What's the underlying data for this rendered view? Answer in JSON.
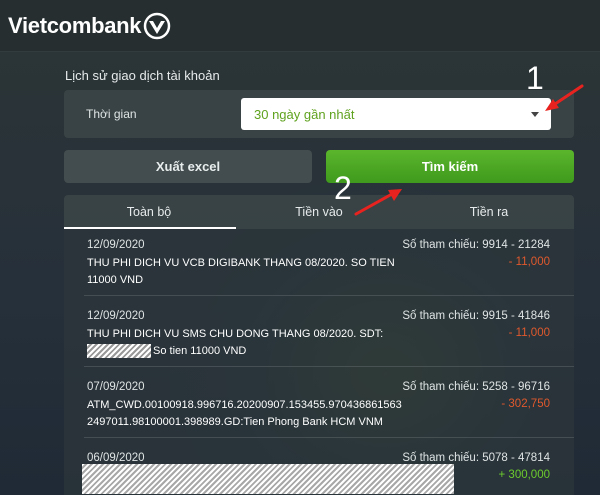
{
  "brand": {
    "name": "Vietcombank"
  },
  "page": {
    "section_title": "Lịch sử giao dịch tài khoản",
    "time_label": "Thời gian",
    "time_value": "30 ngày gần nhất"
  },
  "buttons": {
    "export": "Xuất excel",
    "search": "Tìm kiếm"
  },
  "tabs": [
    {
      "label": "Toàn bộ",
      "active": true
    },
    {
      "label": "Tiền vào",
      "active": false
    },
    {
      "label": "Tiền ra",
      "active": false
    }
  ],
  "transactions": [
    {
      "date": "12/09/2020",
      "description_line1": "THU PHI DICH VU VCB DIGIBANK THANG 08/2020. SO TIEN",
      "description_line2": "11000 VND",
      "reference": "Số tham chiếu: 9914 - 21284",
      "amount": "- 11,000"
    },
    {
      "date": "12/09/2020",
      "description_line1": "THU PHI DICH VU SMS CHU DONG THANG 08/2020. SDT:",
      "description_line2": "So tien 11000 VND",
      "reference": "Số tham chiếu: 9915 - 41846",
      "amount": "- 11,000"
    },
    {
      "date": "07/09/2020",
      "description_line1": "ATM_CWD.00100918.996716.20200907.153455.970436861563",
      "description_line2": "2497011.98100001.398989.GD:Tien Phong Bank HCM VNM",
      "reference": "Số tham chiếu: 5258 - 96716",
      "amount": "- 302,750"
    },
    {
      "date": "06/09/2020",
      "reference": "Số tham chiếu: 5078 - 47814",
      "amount": "+ 300,000"
    }
  ],
  "annotations": {
    "one": "1",
    "two": "2"
  },
  "colors": {
    "accent_green": "#4caf24",
    "negative": "#e0592d",
    "positive": "#6ccc2e",
    "annotation_arrow": "#e8231f"
  }
}
